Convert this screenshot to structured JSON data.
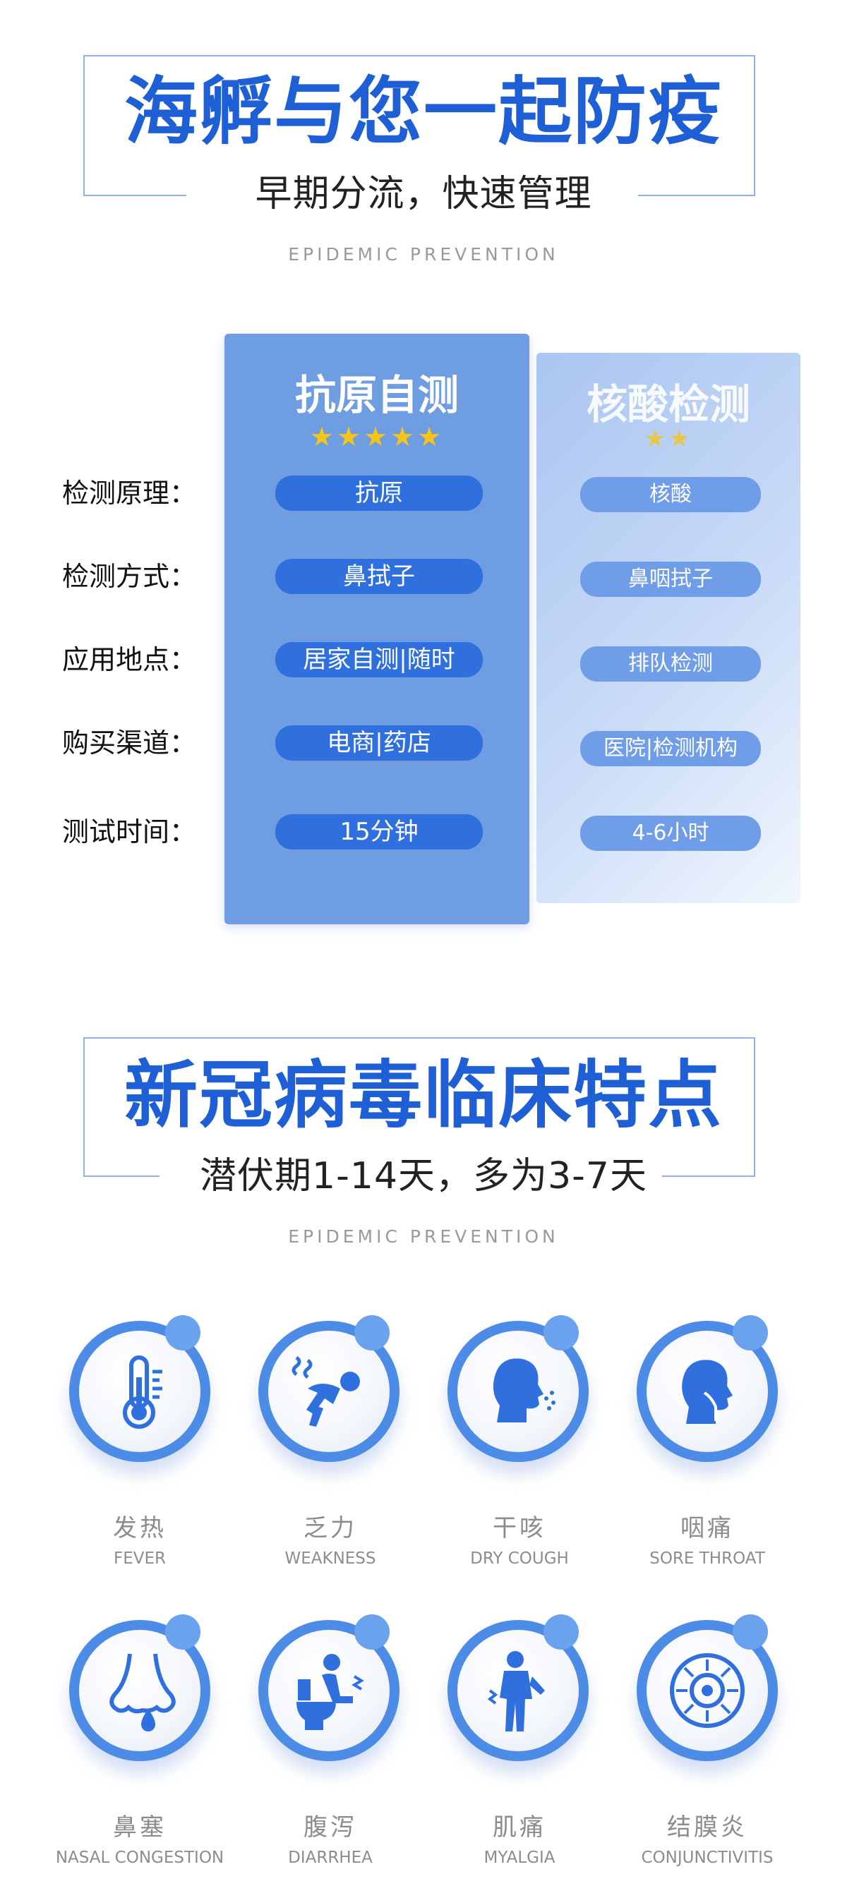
{
  "section1": {
    "title": "海孵与您一起防疫",
    "subtitle": "早期分流，快速管理",
    "english": "EPIDEMIC PREVENTION"
  },
  "comparison": {
    "row_labels": [
      "检测原理：",
      "检测方式：",
      "应用地点：",
      "购买渠道：",
      "测试时间："
    ],
    "col_a": {
      "title": "抗原自测",
      "stars": "★★★★★",
      "star_count": 5,
      "values": [
        "抗原",
        "鼻拭子",
        "居家自测|随时",
        "电商|药店",
        "15分钟"
      ]
    },
    "col_b": {
      "title": "核酸检测",
      "stars": "★★",
      "star_count": 2,
      "values": [
        "核酸",
        "鼻咽拭子",
        "排队检测",
        "医院|检测机构",
        "4-6小时"
      ]
    },
    "colors": {
      "col_a": "#6f9de2",
      "col_b": "#b7cff4",
      "pill_a": "#2f6fde",
      "pill_b": "#6f9de8",
      "star_a": "#f5c518",
      "star_b": "#e8c64a"
    }
  },
  "section2": {
    "title": "新冠病毒临床特点",
    "subtitle": "潜伏期1-14天，多为3-7天",
    "english": "EPIDEMIC PREVENTION"
  },
  "symptoms": [
    {
      "cn": "发热",
      "en": "FEVER",
      "icon": "thermometer-icon"
    },
    {
      "cn": "乏力",
      "en": "WEAKNESS",
      "icon": "fatigue-icon"
    },
    {
      "cn": "干咳",
      "en": "DRY COUGH",
      "icon": "cough-icon"
    },
    {
      "cn": "咽痛",
      "en": "SORE THROAT",
      "icon": "sore-throat-icon"
    },
    {
      "cn": "鼻塞",
      "en": "NASAL CONGESTION",
      "icon": "runny-nose-icon"
    },
    {
      "cn": "腹泻",
      "en": "DIARRHEA",
      "icon": "toilet-icon"
    },
    {
      "cn": "肌痛",
      "en": "MYALGIA",
      "icon": "body-pain-icon"
    },
    {
      "cn": "结膜炎",
      "en": "CONJUNCTIVITIS",
      "icon": "eye-icon"
    }
  ]
}
